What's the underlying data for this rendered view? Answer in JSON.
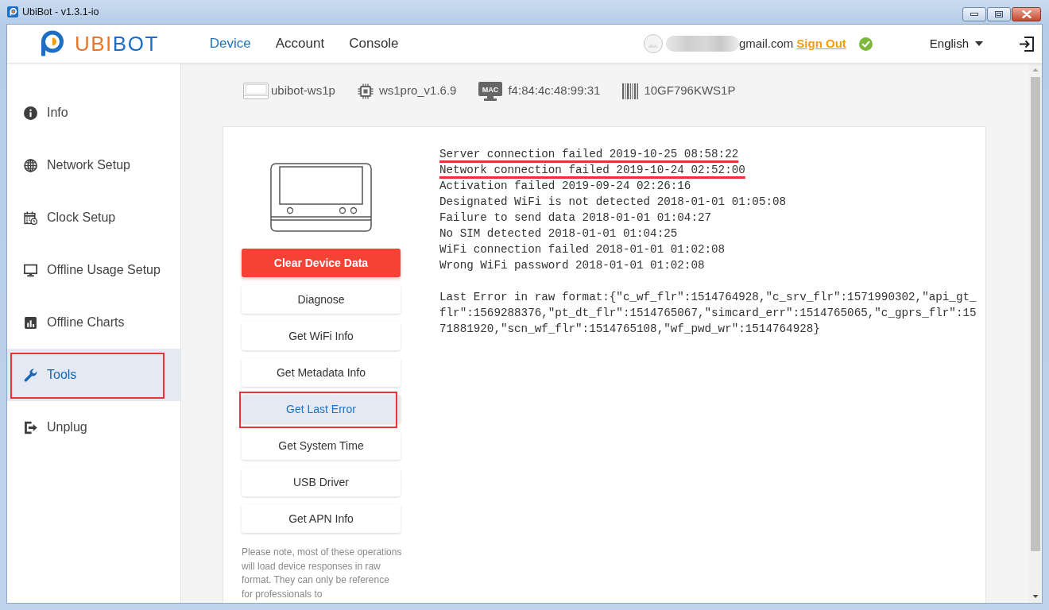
{
  "window": {
    "title": "UbiBot - v1.3.1-io"
  },
  "header": {
    "logo": [
      "UBI",
      "BOT"
    ],
    "nav": [
      {
        "label": "Device",
        "selected": true
      },
      {
        "label": "Account",
        "selected": false
      },
      {
        "label": "Console",
        "selected": false
      }
    ],
    "account": {
      "email_visible": "gmail.com",
      "sign_out": "Sign Out",
      "connected": true
    },
    "language": "English"
  },
  "sidebar": {
    "items": [
      {
        "label": "Info",
        "selected": false,
        "highlighted": false
      },
      {
        "label": "Network Setup",
        "selected": false,
        "highlighted": false
      },
      {
        "label": "Clock Setup",
        "selected": false,
        "highlighted": false
      },
      {
        "label": "Offline Usage Setup",
        "selected": false,
        "highlighted": false
      },
      {
        "label": "Offline Charts",
        "selected": false,
        "highlighted": false
      },
      {
        "label": "Tools",
        "selected": true,
        "highlighted": true
      },
      {
        "label": "Unplug",
        "selected": false,
        "highlighted": false
      }
    ]
  },
  "device_info": [
    {
      "text": "ubibot-ws1p"
    },
    {
      "text": "ws1pro_v1.6.9"
    },
    {
      "text": "f4:84:4c:48:99:31",
      "icon_text": "MAC"
    },
    {
      "text": "10GF796KWS1P"
    }
  ],
  "tools": {
    "buttons": [
      {
        "label": "Clear Device Data",
        "kind": "danger",
        "selected": false,
        "highlighted": false
      },
      {
        "label": "Diagnose",
        "kind": "default",
        "selected": false,
        "highlighted": false
      },
      {
        "label": "Get WiFi Info",
        "kind": "default",
        "selected": false,
        "highlighted": false
      },
      {
        "label": "Get Metadata Info",
        "kind": "default",
        "selected": false,
        "highlighted": false
      },
      {
        "label": "Get Last Error",
        "kind": "default",
        "selected": true,
        "highlighted": true
      },
      {
        "label": "Get System Time",
        "kind": "default",
        "selected": false,
        "highlighted": false
      },
      {
        "label": "USB Driver",
        "kind": "default",
        "selected": false,
        "highlighted": false
      },
      {
        "label": "Get APN Info",
        "kind": "default",
        "selected": false,
        "highlighted": false
      }
    ],
    "note": "Please note, most of these operations will load device responses in raw format. They can only be reference for professionals to"
  },
  "output": {
    "log": [
      {
        "text": "Server connection failed 2019-10-25 08:58:22",
        "underlined": true
      },
      {
        "text": "Network connection failed 2019-10-24 02:52:00",
        "underlined": true
      },
      {
        "text": "Activation failed 2019-09-24 02:26:16",
        "underlined": false
      },
      {
        "text": "Designated WiFi is not detected 2018-01-01 01:05:08",
        "underlined": false
      },
      {
        "text": "Failure to send data 2018-01-01 01:04:27",
        "underlined": false
      },
      {
        "text": "No SIM detected 2018-01-01 01:04:25",
        "underlined": false
      },
      {
        "text": "WiFi connection failed 2018-01-01 01:02:08",
        "underlined": false
      },
      {
        "text": "Wrong WiFi password 2018-01-01 01:02:08",
        "underlined": false
      }
    ],
    "raw_error": "Last Error in raw format:{\"c_wf_flr\":1514764928,\"c_srv_flr\":1571990302,\"api_gt_flr\":1569288376,\"pt_dt_flr\":1514765067,\"simcard_err\":1514765065,\"c_gprs_flr\":1571881920,\"scn_wf_flr\":1514765108,\"wf_pwd_wr\":1514764928}"
  }
}
